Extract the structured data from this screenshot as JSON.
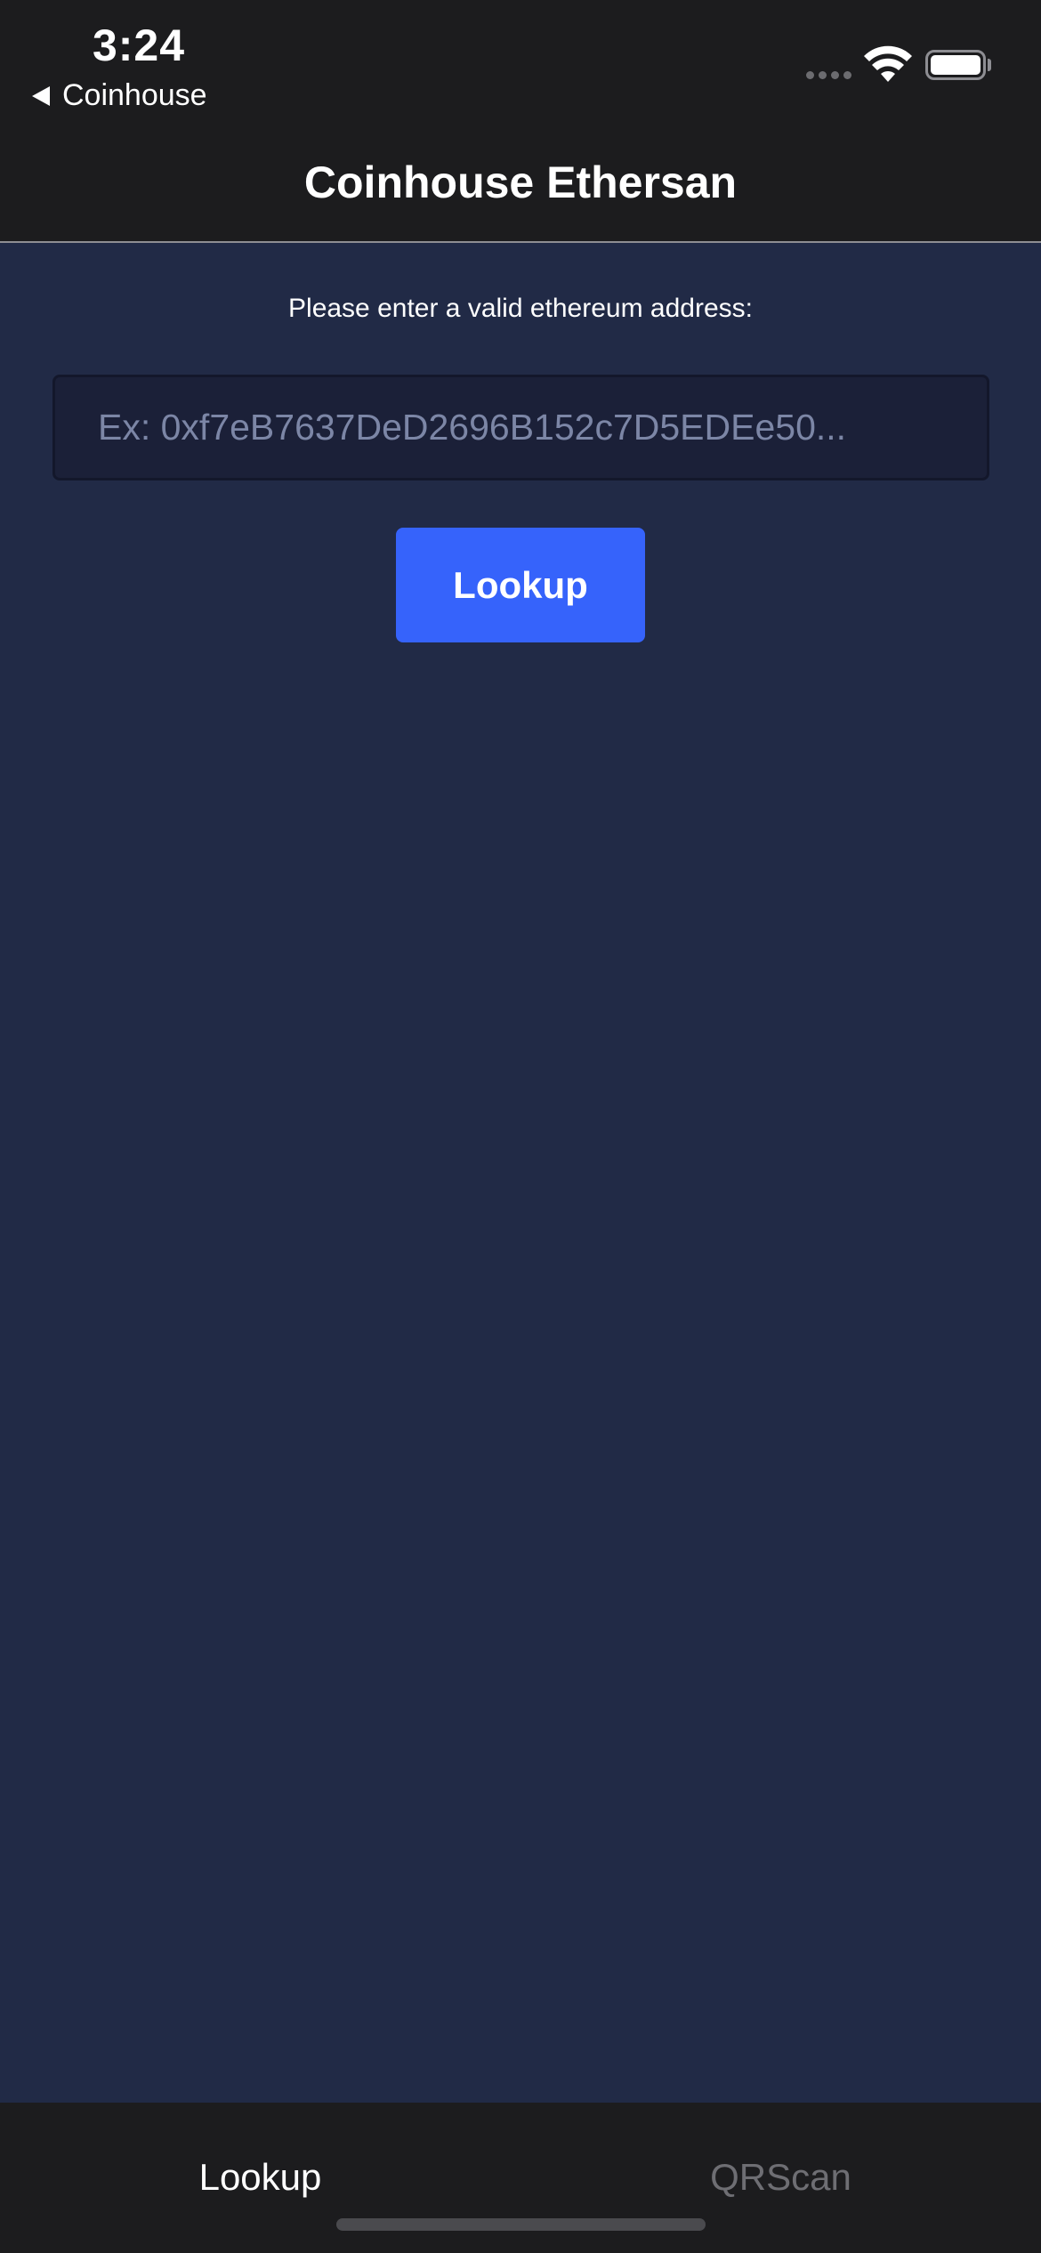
{
  "status_bar": {
    "time": "3:24",
    "back_app": "Coinhouse"
  },
  "nav": {
    "title": "Coinhouse Ethersan"
  },
  "form": {
    "prompt": "Please enter a valid ethereum address:",
    "address_placeholder": "Ex: 0xf7eB7637DeD2696B152c7D5EDEe50...",
    "address_value": "",
    "lookup_label": "Lookup"
  },
  "tabs": [
    {
      "label": "Lookup",
      "active": true
    },
    {
      "label": "QRScan",
      "active": false
    }
  ],
  "colors": {
    "background": "#212a46",
    "header": "#1c1c1e",
    "input_background": "#1b2038",
    "button": "#3663fb",
    "inactive_tab": "#6e6e73"
  },
  "icons": [
    "back-arrow-icon",
    "cellular-signal-icon",
    "wifi-icon",
    "battery-icon"
  ]
}
